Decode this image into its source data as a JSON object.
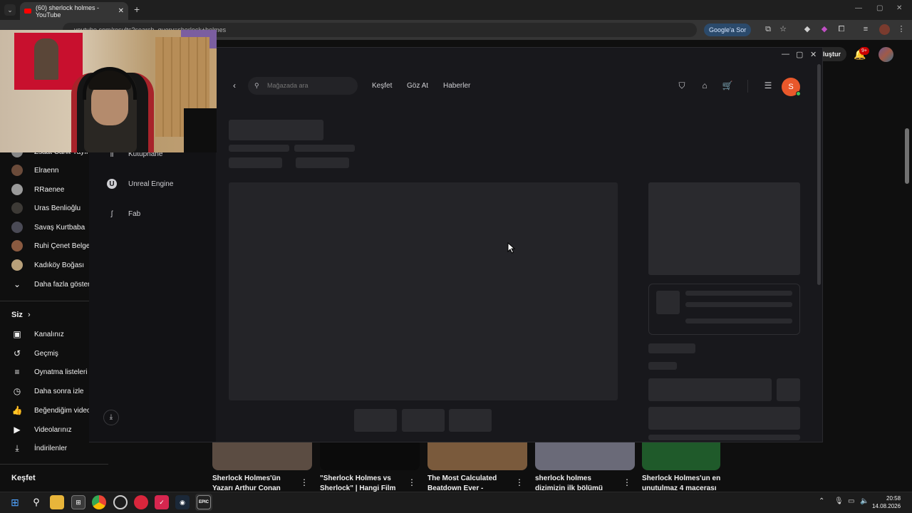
{
  "browser": {
    "tab_title": "(60) sherlock holmes - YouTube",
    "url": "youtube.com/results?search_query=sherlock+holmes",
    "google_sor_label": "Google'a Sor",
    "new_tab": "+",
    "tab_close": "✕"
  },
  "youtube": {
    "sidebar": {
      "subscriptions": [
        {
          "label": "Zsaat Cahit Yayın"
        },
        {
          "label": "Elraenn"
        },
        {
          "label": "RRaenee"
        },
        {
          "label": "Uras Benlioğlu"
        },
        {
          "label": "Savaş Kurtbaba"
        },
        {
          "label": "Ruhi Çenet Belgesel"
        },
        {
          "label": "Kadıköy Boğası"
        }
      ],
      "show_more": "Daha fazla göster",
      "you_section_title": "Siz",
      "you_items": [
        {
          "label": "Kanalınız",
          "icon": "channel-icon"
        },
        {
          "label": "Geçmiş",
          "icon": "history-icon"
        },
        {
          "label": "Oynatma listeleri",
          "icon": "playlists-icon"
        },
        {
          "label": "Daha sonra izle",
          "icon": "watch-later-icon"
        },
        {
          "label": "Beğendiğim videolar",
          "icon": "like-icon"
        },
        {
          "label": "Videolarınız",
          "icon": "your-videos-icon"
        },
        {
          "label": "İndirilenler",
          "icon": "downloads-icon"
        }
      ],
      "explore_title": "Keşfet"
    },
    "topbar": {
      "create_label": "Oluştur",
      "notifications_badge": "9+"
    },
    "videos": [
      {
        "title": "Sherlock Holmes'ün Yazarı Arthur Conan",
        "thumb_color": "#5b4c42"
      },
      {
        "title": "\"Sherlock Holmes vs Sherlock\" | Hangi Film",
        "thumb_color": "#0b0b0b"
      },
      {
        "title": "The Most Calculated Beatdown Ever -",
        "thumb_color": "#7a5a3c"
      },
      {
        "title": "sherlock holmes dizimizin ilk bölümü",
        "thumb_color": "#6a6a78"
      },
      {
        "title": "Sherlock Holmes'un en unutulmaz 4 macerası",
        "thumb_color": "#1f5a2a"
      }
    ]
  },
  "epic": {
    "sidebar": [
      {
        "label": "Kütüphane",
        "icon": "library-icon"
      },
      {
        "label": "Unreal Engine",
        "icon": "unreal-engine-icon"
      },
      {
        "label": "Fab",
        "icon": "fab-icon"
      }
    ],
    "search_placeholder": "Mağazada ara",
    "nav": [
      "Keşfet",
      "Göz At",
      "Haberler"
    ],
    "avatar_initial": "S"
  },
  "taskbar": {
    "time": "20:58",
    "date": "14.08.2026"
  },
  "colors": {
    "youtube_red": "#ff0000",
    "epic_avatar": "#e8582b",
    "online": "#3fbf5a"
  }
}
